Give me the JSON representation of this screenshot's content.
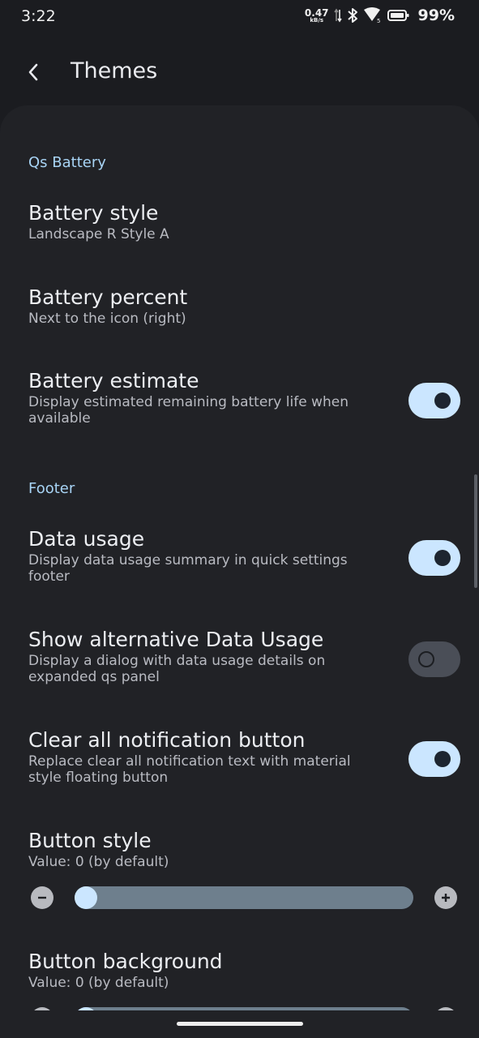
{
  "status": {
    "time": "3:22",
    "net_speed": "0.47",
    "net_unit": "kB/s",
    "battery_pct": "99%"
  },
  "app_bar": {
    "title": "Themes"
  },
  "sections": {
    "qs_battery": {
      "header": "Qs Battery",
      "battery_style": {
        "title": "Battery style",
        "summary": "Landscape R Style A"
      },
      "battery_percent": {
        "title": "Battery percent",
        "summary": "Next to the icon (right)"
      },
      "battery_estimate": {
        "title": "Battery estimate",
        "summary": "Display estimated remaining battery life when available",
        "enabled": true
      }
    },
    "footer": {
      "header": "Footer",
      "data_usage": {
        "title": "Data usage",
        "summary": "Display data usage summary in quick settings footer",
        "enabled": true
      },
      "alt_data_usage": {
        "title": "Show alternative Data Usage",
        "summary": "Display a dialog with data usage details on expanded qs panel",
        "enabled": false
      },
      "clear_all_button": {
        "title": "Clear all notification button",
        "summary": "Replace clear all notification text with material style floating button",
        "enabled": true
      },
      "button_style": {
        "title": "Button style",
        "summary": "Value: 0 (by default)",
        "value": 0
      },
      "button_background": {
        "title": "Button background",
        "summary": "Value: 0 (by default)",
        "value": 0
      }
    }
  },
  "colors": {
    "accent": "#a8d4f5",
    "toggle_on": "#cbe6ff",
    "background": "#1b1c20",
    "card": "#212226"
  }
}
